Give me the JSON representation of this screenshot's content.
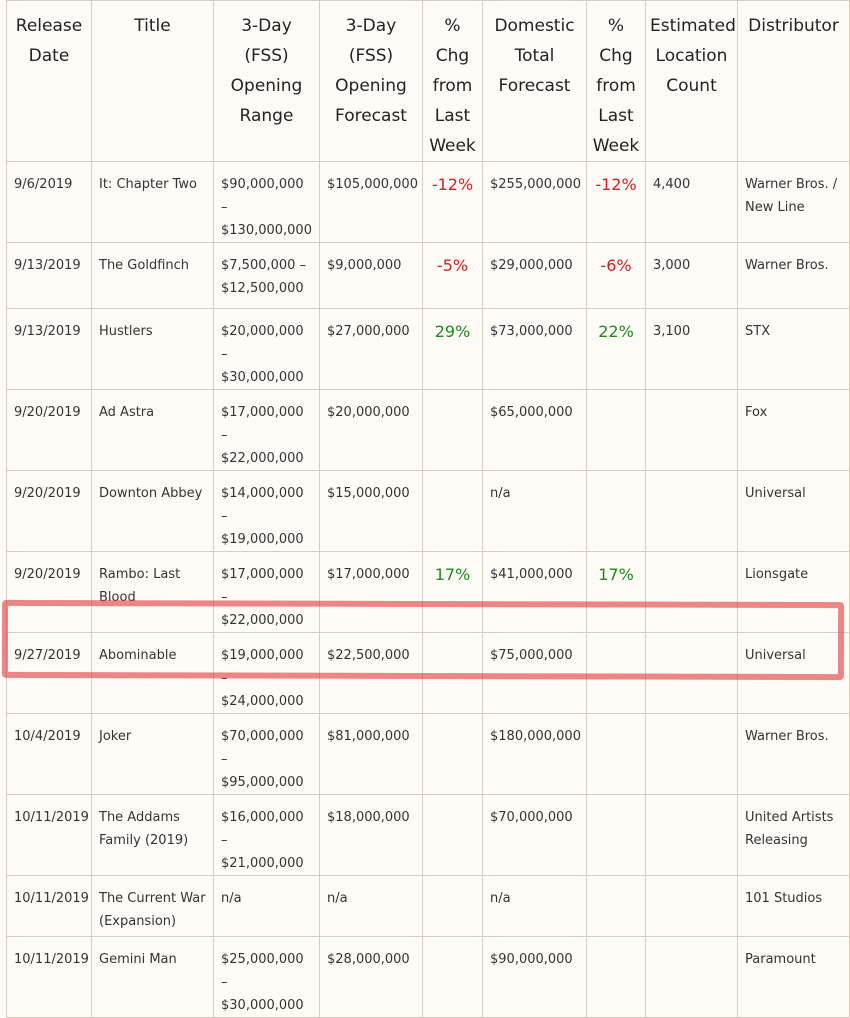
{
  "headers": {
    "release_date": "Release Date",
    "title": "Title",
    "opening_range": "3-Day (FSS) Opening Range",
    "opening_forecast": "3-Day (FSS) Opening Forecast",
    "pct_chg_opening": "% Chg from Last Week",
    "domestic_total": "Domestic Total Forecast",
    "pct_chg_total": "% Chg from Last Week",
    "location_count": "Estimated Location Count",
    "distributor": "Distributor"
  },
  "rows": [
    {
      "date": "9/6/2019",
      "title": "It: Chapter Two",
      "range": "$90,000,000 – $130,000,000",
      "forecast": "$105,000,000",
      "pct1": "-12%",
      "total": "$255,000,000",
      "pct2": "-12%",
      "locations": "4,400",
      "distributor": "Warner Bros. / New Line"
    },
    {
      "date": "9/13/2019",
      "title": "The Goldfinch",
      "range": "$7,500,000 – $12,500,000",
      "forecast": "$9,000,000",
      "pct1": "-5%",
      "total": "$29,000,000",
      "pct2": "-6%",
      "locations": "3,000",
      "distributor": "Warner Bros."
    },
    {
      "date": "9/13/2019",
      "title": "Hustlers",
      "range": "$20,000,000 – $30,000,000",
      "forecast": "$27,000,000",
      "pct1": "29%",
      "total": "$73,000,000",
      "pct2": "22%",
      "locations": "3,100",
      "distributor": "STX"
    },
    {
      "date": "9/20/2019",
      "title": "Ad Astra",
      "range": "$17,000,000 – $22,000,000",
      "forecast": "$20,000,000",
      "pct1": "",
      "total": "$65,000,000",
      "pct2": "",
      "locations": "",
      "distributor": "Fox"
    },
    {
      "date": "9/20/2019",
      "title": "Downton Abbey",
      "range": "$14,000,000 – $19,000,000",
      "forecast": "$15,000,000",
      "pct1": "",
      "total": "n/a",
      "pct2": "",
      "locations": "",
      "distributor": "Universal"
    },
    {
      "date": "9/20/2019",
      "title": "Rambo: Last Blood",
      "range": "$17,000,000 – $22,000,000",
      "forecast": "$17,000,000",
      "pct1": "17%",
      "total": "$41,000,000",
      "pct2": "17%",
      "locations": "",
      "distributor": "Lionsgate"
    },
    {
      "date": "9/27/2019",
      "title": "Abominable",
      "range": "$19,000,000 – $24,000,000",
      "forecast": "$22,500,000",
      "pct1": "",
      "total": "$75,000,000",
      "pct2": "",
      "locations": "",
      "distributor": "Universal"
    },
    {
      "date": "10/4/2019",
      "title": "Joker",
      "range": "$70,000,000 – $95,000,000",
      "forecast": "$81,000,000",
      "pct1": "",
      "total": "$180,000,000",
      "pct2": "",
      "locations": "",
      "distributor": "Warner Bros."
    },
    {
      "date": "10/11/2019",
      "title": "The Addams Family (2019)",
      "range": "$16,000,000 – $21,000,000",
      "forecast": "$18,000,000",
      "pct1": "",
      "total": "$70,000,000",
      "pct2": "",
      "locations": "",
      "distributor": "United Artists Releasing"
    },
    {
      "date": "10/11/2019",
      "title": "The Current War (Expansion)",
      "range": "n/a",
      "forecast": "n/a",
      "pct1": "",
      "total": "n/a",
      "pct2": "",
      "locations": "",
      "distributor": "101 Studios"
    },
    {
      "date": "10/11/2019",
      "title": "Gemini Man",
      "range": "$25,000,000 – $30,000,000",
      "forecast": "$28,000,000",
      "pct1": "",
      "total": "$90,000,000",
      "pct2": "",
      "locations": "",
      "distributor": "Paramount"
    }
  ],
  "colors": {
    "negative": "#d42020",
    "positive": "#1b8a1b",
    "highlight": "#e04646"
  }
}
